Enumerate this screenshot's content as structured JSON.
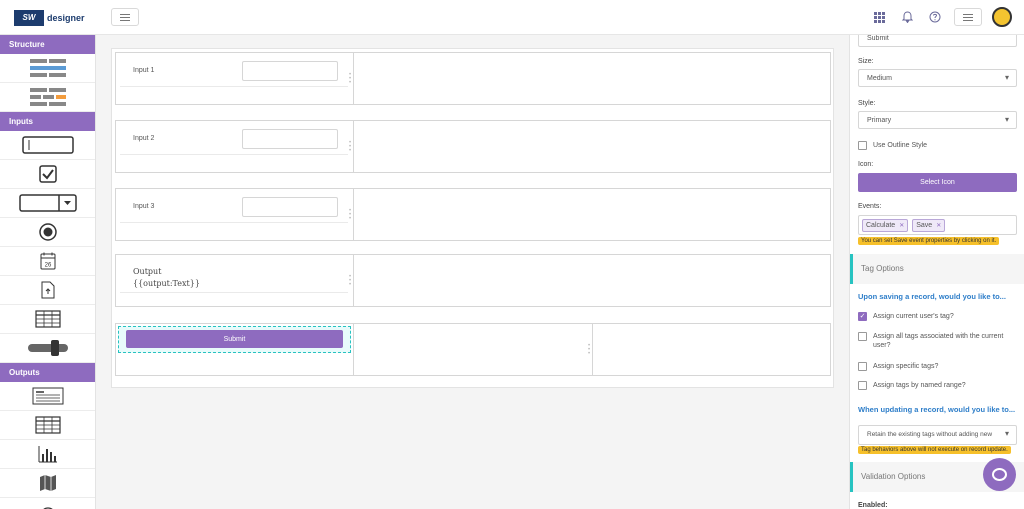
{
  "header": {
    "logo_mark": "SW",
    "logo_text": "designer"
  },
  "toolbox": {
    "sections": {
      "structure": "Structure",
      "inputs": "Inputs",
      "outputs": "Outputs"
    },
    "date_icon_day": "26"
  },
  "canvas": {
    "input1_label": "Input 1",
    "input2_label": "Input 2",
    "input3_label": "Input 3",
    "output_title": "Output",
    "output_expr": "{{output:Text}}",
    "submit_label": "Submit"
  },
  "panel": {
    "text_value": "Submit",
    "size_label": "Size:",
    "size_value": "Medium",
    "style_label": "Style:",
    "style_value": "Primary",
    "outline_label": "Use Outline Style",
    "icon_label": "Icon:",
    "select_icon": "Select Icon",
    "events_label": "Events:",
    "event_tags": [
      "Calculate",
      "Save"
    ],
    "events_note": "You can set Save event properties by clicking on it.",
    "tag_options_head": "Tag Options",
    "saving_question": "Upon saving a record, would you like to...",
    "opt_current": "Assign current user's tag?",
    "opt_all": "Assign all tags associated with the current user?",
    "opt_specific": "Assign specific tags?",
    "opt_named": "Assign tags by named range?",
    "updating_question": "When updating a record, would you like to...",
    "update_select": "Retain the existing tags without adding new",
    "update_note": "Tag behaviors above will not execute on record update.",
    "validation_head": "Validation Options",
    "enabled_label": "Enabled:"
  },
  "colors": {
    "accent": "#8e6bbf",
    "selection": "#27c3c1",
    "note": "#f6c02a",
    "link": "#2e7ec9"
  }
}
